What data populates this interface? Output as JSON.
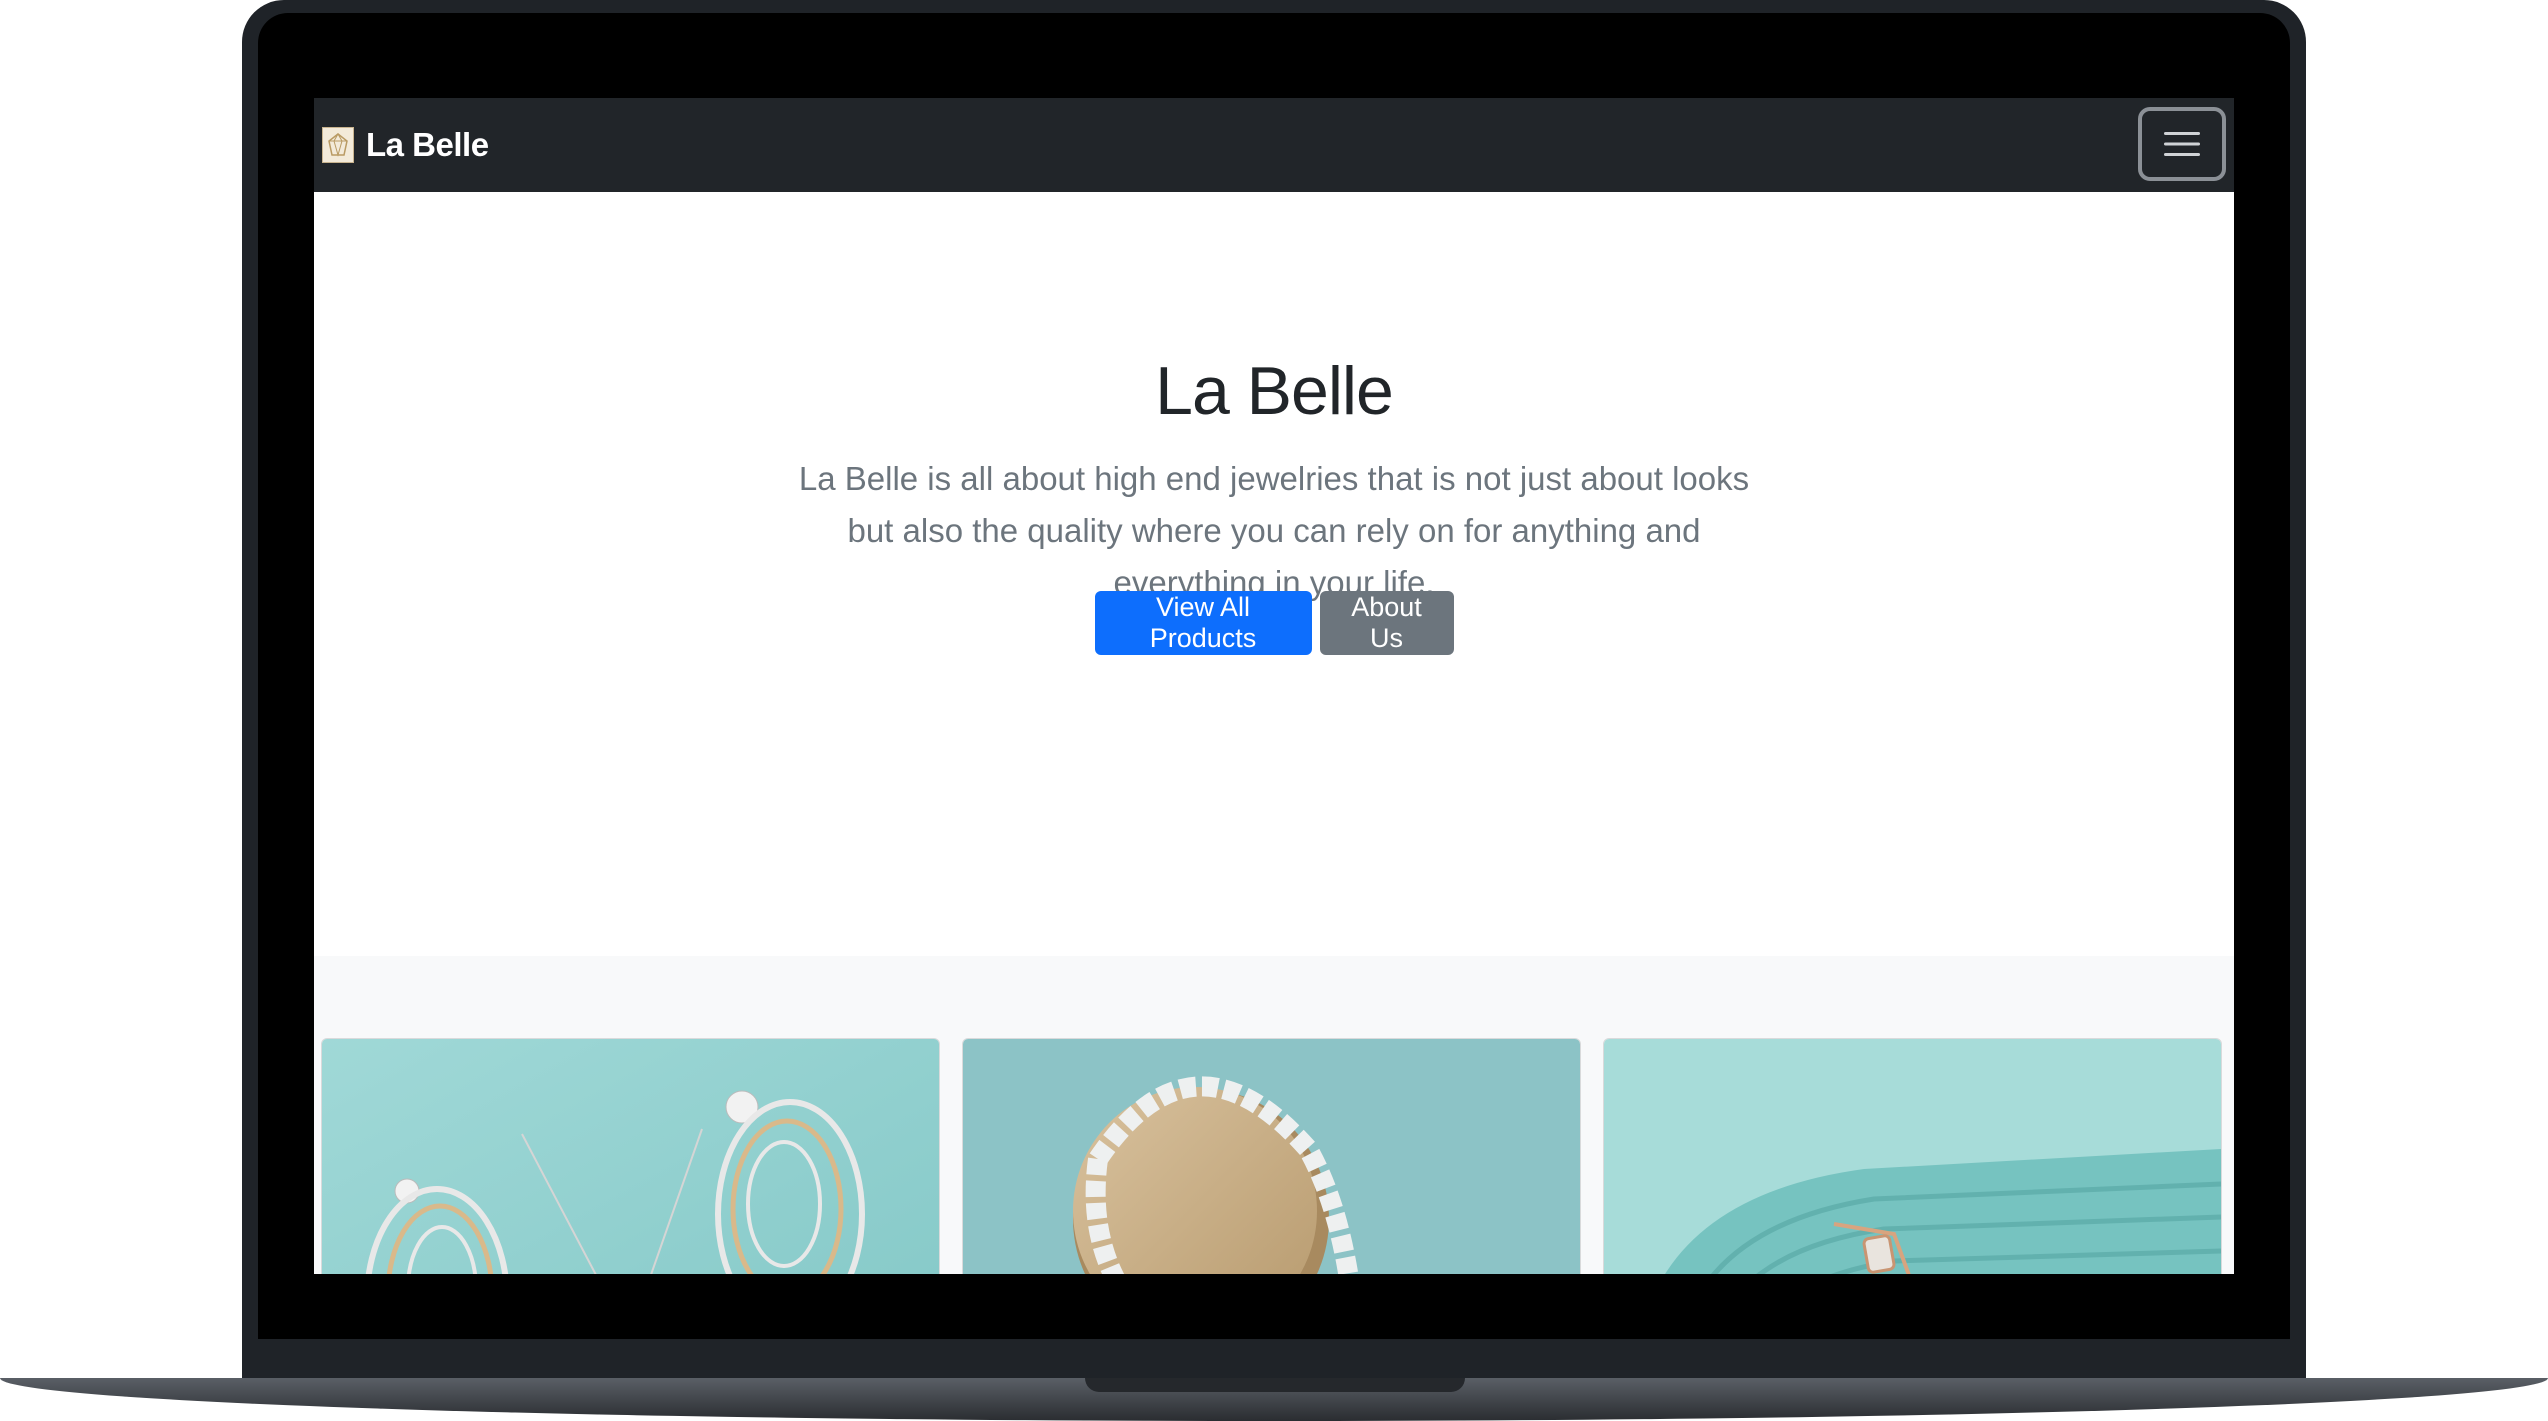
{
  "navbar": {
    "brand": "La Belle",
    "logo_icon": "jewel-logo-icon",
    "toggler_icon": "hamburger-menu-icon"
  },
  "hero": {
    "title": "La Belle",
    "description": "La Belle is all about high end jewelries that is not just about looks but also the quality where you can rely on for anything and everything in your life.",
    "primary_button": "View All Products",
    "secondary_button": "About Us"
  },
  "colors": {
    "navbar_bg": "#212529",
    "primary": "#0d6efd",
    "secondary": "#6c757d",
    "text_muted": "#6c757d",
    "section_bg": "#f8f9fa"
  },
  "products": [
    {
      "image": "earrings-and-pendant-image"
    },
    {
      "image": "tennis-necklace-image"
    },
    {
      "image": "bracelet-image"
    }
  ]
}
